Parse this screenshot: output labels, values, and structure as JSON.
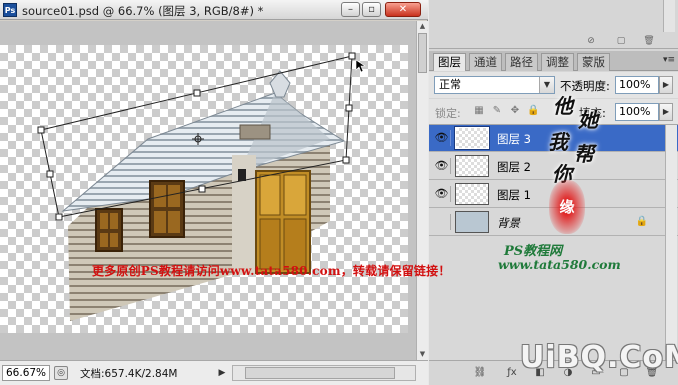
{
  "document": {
    "title": "source01.psd @ 66.7% (图层 3, RGB/8#) *",
    "zoom": "66.67%",
    "doc_info": "文档:657.4K/2.84M"
  },
  "panel": {
    "tabs": [
      "图层",
      "通道",
      "路径",
      "调整",
      "蒙版"
    ],
    "blend_mode": "正常",
    "opacity_label": "不透明度:",
    "opacity_value": "100%",
    "lock_label": "锁定:",
    "fill_label": "填充:",
    "fill_value": "100%",
    "layers": [
      {
        "name": "图层 3",
        "selected": true,
        "visible": true
      },
      {
        "name": "图层 2",
        "selected": false,
        "visible": true
      },
      {
        "name": "图层 1",
        "selected": false,
        "visible": true
      },
      {
        "name": "背景",
        "selected": false,
        "visible": false,
        "locked": true
      }
    ]
  },
  "overlays": {
    "credit_line": "更多原创PS教程请访问www.tata580.com，转载请保留链接！",
    "script_credit": "PS教程网",
    "script_site": "www.tata580.com",
    "calligraphy": [
      "他",
      "她",
      "我",
      "帮",
      "你"
    ],
    "seal": "缘",
    "watermark": "UiBQ.CoM"
  },
  "colors": {
    "selection_blue": "#3a6ac6",
    "credit_red": "#d21010",
    "script_green": "#1f7a3a"
  }
}
